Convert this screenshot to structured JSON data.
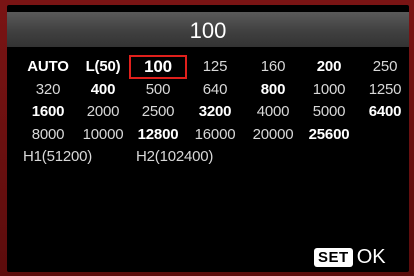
{
  "header": {
    "title": "100"
  },
  "iso_rows": [
    [
      {
        "label": "AUTO",
        "bold": true
      },
      {
        "label": "L(50)",
        "bold": true
      },
      {
        "label": "100",
        "bold": true,
        "selected": true
      },
      {
        "label": "125"
      },
      {
        "label": "160"
      },
      {
        "label": "200",
        "bold": true
      },
      {
        "label": "250"
      }
    ],
    [
      {
        "label": "320"
      },
      {
        "label": "400",
        "bold": true
      },
      {
        "label": "500"
      },
      {
        "label": "640"
      },
      {
        "label": "800",
        "bold": true
      },
      {
        "label": "1000"
      },
      {
        "label": "1250"
      }
    ],
    [
      {
        "label": "1600",
        "bold": true
      },
      {
        "label": "2000"
      },
      {
        "label": "2500"
      },
      {
        "label": "3200",
        "bold": true
      },
      {
        "label": "4000"
      },
      {
        "label": "5000"
      },
      {
        "label": "6400",
        "bold": true
      }
    ],
    [
      {
        "label": "8000"
      },
      {
        "label": "10000"
      },
      {
        "label": "12800",
        "bold": true
      },
      {
        "label": "16000"
      },
      {
        "label": "20000"
      },
      {
        "label": "25600",
        "bold": true
      }
    ],
    [
      {
        "label": "H1(51200)",
        "wide": true
      },
      {
        "label": "H2(102400)",
        "wide": true
      }
    ]
  ],
  "footer": {
    "set_label": "SET",
    "ok_label": "OK"
  },
  "colors": {
    "selection_border": "#e0201c",
    "bezel": "#6e1010",
    "screen": "#000000"
  }
}
